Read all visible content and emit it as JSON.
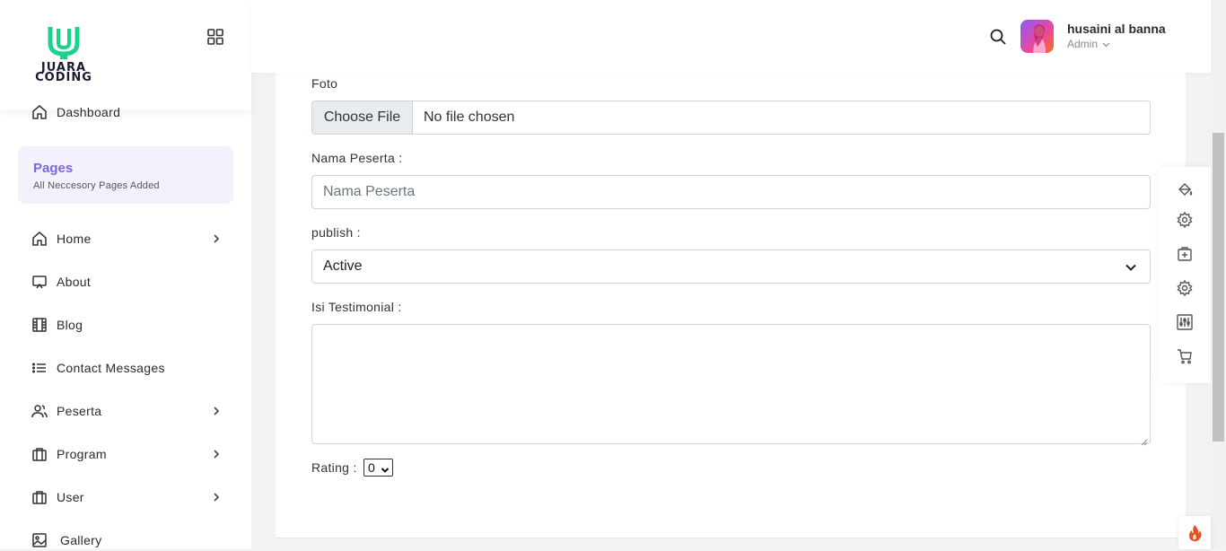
{
  "sidebar": {
    "logo_line1": "JUARA",
    "logo_line2": "CODING",
    "dashboard": "Dashboard",
    "pages_title": "Pages",
    "pages_subtitle": "All Neccesory Pages Added",
    "items": [
      {
        "label": "Home",
        "icon": "home-icon",
        "has_submenu": true
      },
      {
        "label": "About",
        "icon": "screen-icon",
        "has_submenu": false
      },
      {
        "label": "Blog",
        "icon": "film-icon",
        "has_submenu": false
      },
      {
        "label": "Contact Messages",
        "icon": "list-icon",
        "has_submenu": false
      },
      {
        "label": "Peserta",
        "icon": "users-icon",
        "has_submenu": true
      },
      {
        "label": "Program",
        "icon": "briefcase-icon",
        "has_submenu": true
      },
      {
        "label": "User",
        "icon": "briefcase-icon",
        "has_submenu": true
      },
      {
        "label": "Gallery",
        "icon": "image-icon",
        "has_submenu": false
      }
    ]
  },
  "header": {
    "user_name": "husaini al banna",
    "user_role": "Admin"
  },
  "form": {
    "foto_label": "Foto",
    "file_button": "Choose File",
    "file_status": "No file chosen",
    "nama_label": "Nama Peserta :",
    "nama_placeholder": "Nama Peserta",
    "nama_value": "",
    "publish_label": "publish :",
    "publish_value": "Active",
    "isi_label": "Isi Testimonial :",
    "isi_value": "",
    "rating_label": "Rating :",
    "rating_value": "0"
  },
  "colors": {
    "accent": "#7a66e0",
    "logo_green": "#19d38a",
    "fire": "#e8501e"
  },
  "tools": [
    "paint-bucket-icon",
    "gear-icon",
    "briefcase-plus-icon",
    "gear-icon",
    "sliders-icon",
    "cart-icon"
  ]
}
